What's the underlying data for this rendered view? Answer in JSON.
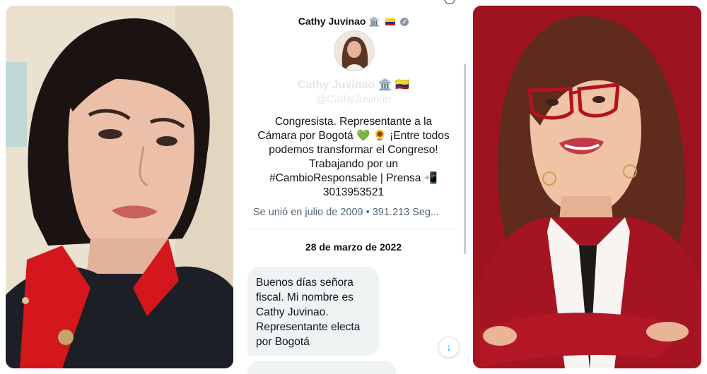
{
  "profile": {
    "top_name": "Cathy Juvinao",
    "top_icons": "🏛️",
    "ghost_name": "Cathy Juvinao 🏛️ 🇨🇴",
    "ghost_handle": "@CathyJuvinao",
    "bio_lines": [
      "Congresista. Representante a la",
      "Cámara por Bogotá 💚 🌻 ¡Entre todos",
      "podemos transformar el Congreso!",
      "Trabajando por un",
      "#CambioResponsable | Prensa 📲",
      "3013953521"
    ],
    "joined": "Se unió en julio de 2009 • 391.213 Seg..."
  },
  "conversation": {
    "date_header": "28 de marzo de 2022",
    "message_lines": [
      "Buenos días señora",
      "fiscal. Mi nombre es",
      "Cathy Juvinao.",
      "Representante electa",
      "por Bogotá"
    ],
    "scroll_down_icon": "↓"
  },
  "colors": {
    "left_collar": "#d4161d",
    "right_background": "#9e1320",
    "right_blazer": "#a51422",
    "twitter_blue": "#1d9bf0"
  }
}
